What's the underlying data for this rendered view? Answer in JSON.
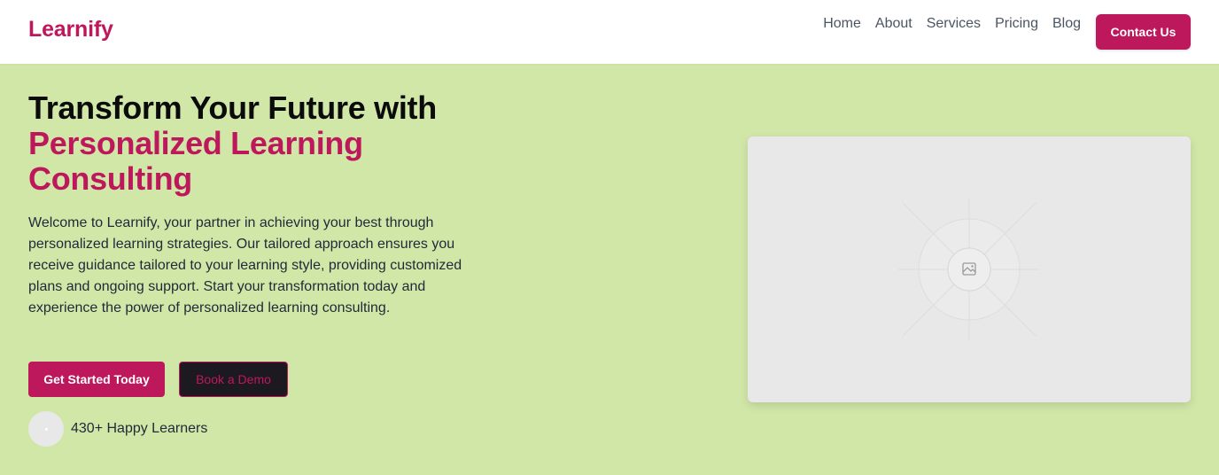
{
  "brand": {
    "name": "Learnify",
    "accent_color": "#be185d"
  },
  "nav": {
    "links": [
      "Home",
      "About",
      "Services",
      "Pricing",
      "Blog"
    ],
    "cta_label": "Contact Us"
  },
  "hero": {
    "title_line1": "Transform Your Future with",
    "title_accent": "Personalized Learning Consulting",
    "description": "Welcome to Learnify, your partner in achieving your best through personalized learning strategies. Our tailored approach ensures you receive guidance tailored to your learning style, providing customized plans and ongoing support. Start your transformation today and experience the power of personalized learning consulting.",
    "primary_button": "Get Started Today",
    "secondary_button": "Book a Demo",
    "social_proof": "430+ Happy Learners",
    "image_icon": "image-placeholder-icon",
    "background_color": "#d1e7a8"
  }
}
